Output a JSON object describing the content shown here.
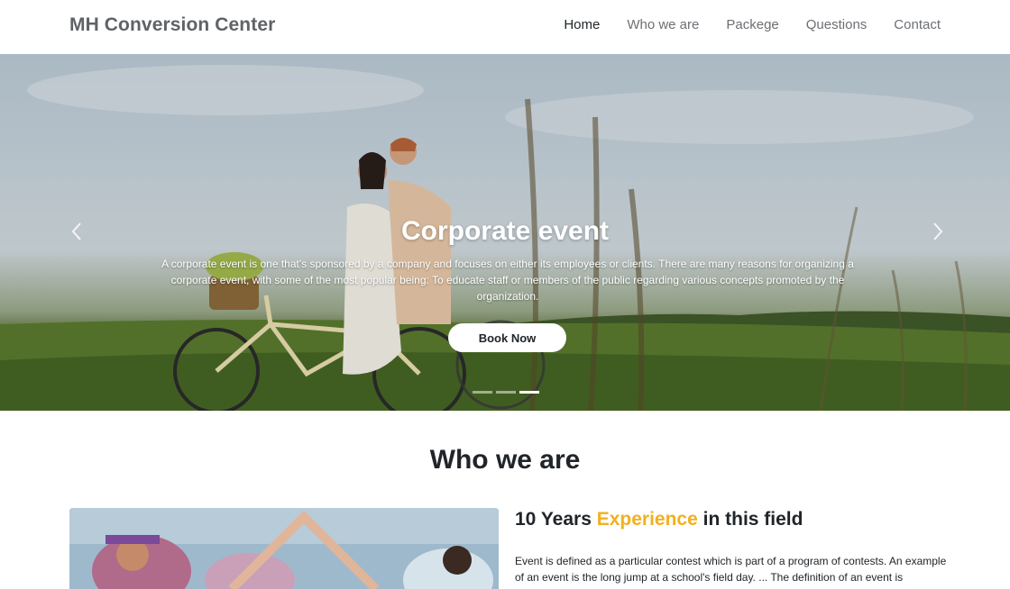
{
  "navbar": {
    "brand": "MH Conversion Center",
    "links": [
      {
        "label": "Home",
        "active": true
      },
      {
        "label": "Who we are"
      },
      {
        "label": "Packege"
      },
      {
        "label": "Questions"
      },
      {
        "label": "Contact"
      }
    ]
  },
  "hero": {
    "title": "Corporate event",
    "text": "A corporate event is one that's sponsored by a company and focuses on either its employees or clients. There are many reasons for organizing a corporate event, with some of the most popular being: To educate staff or members of the public regarding various concepts promoted by the organization.",
    "button_label": "Book Now",
    "prev_icon": "chevron-left-icon",
    "next_icon": "chevron-right-icon",
    "indicators_count": 3,
    "active_indicator": 3
  },
  "about": {
    "section_title": "Who we are",
    "heading_part1": "10 Years ",
    "heading_highlight": "Experience",
    "heading_part2": " in this field",
    "text": "Event is defined as a particular contest which is part of a program of contests. An example of an event is the long jump at a school's field day. ... The definition of an event is"
  },
  "colors": {
    "highlight": "#f2b01e",
    "brand": "#5f6368",
    "button_bg": "#ffffff"
  }
}
